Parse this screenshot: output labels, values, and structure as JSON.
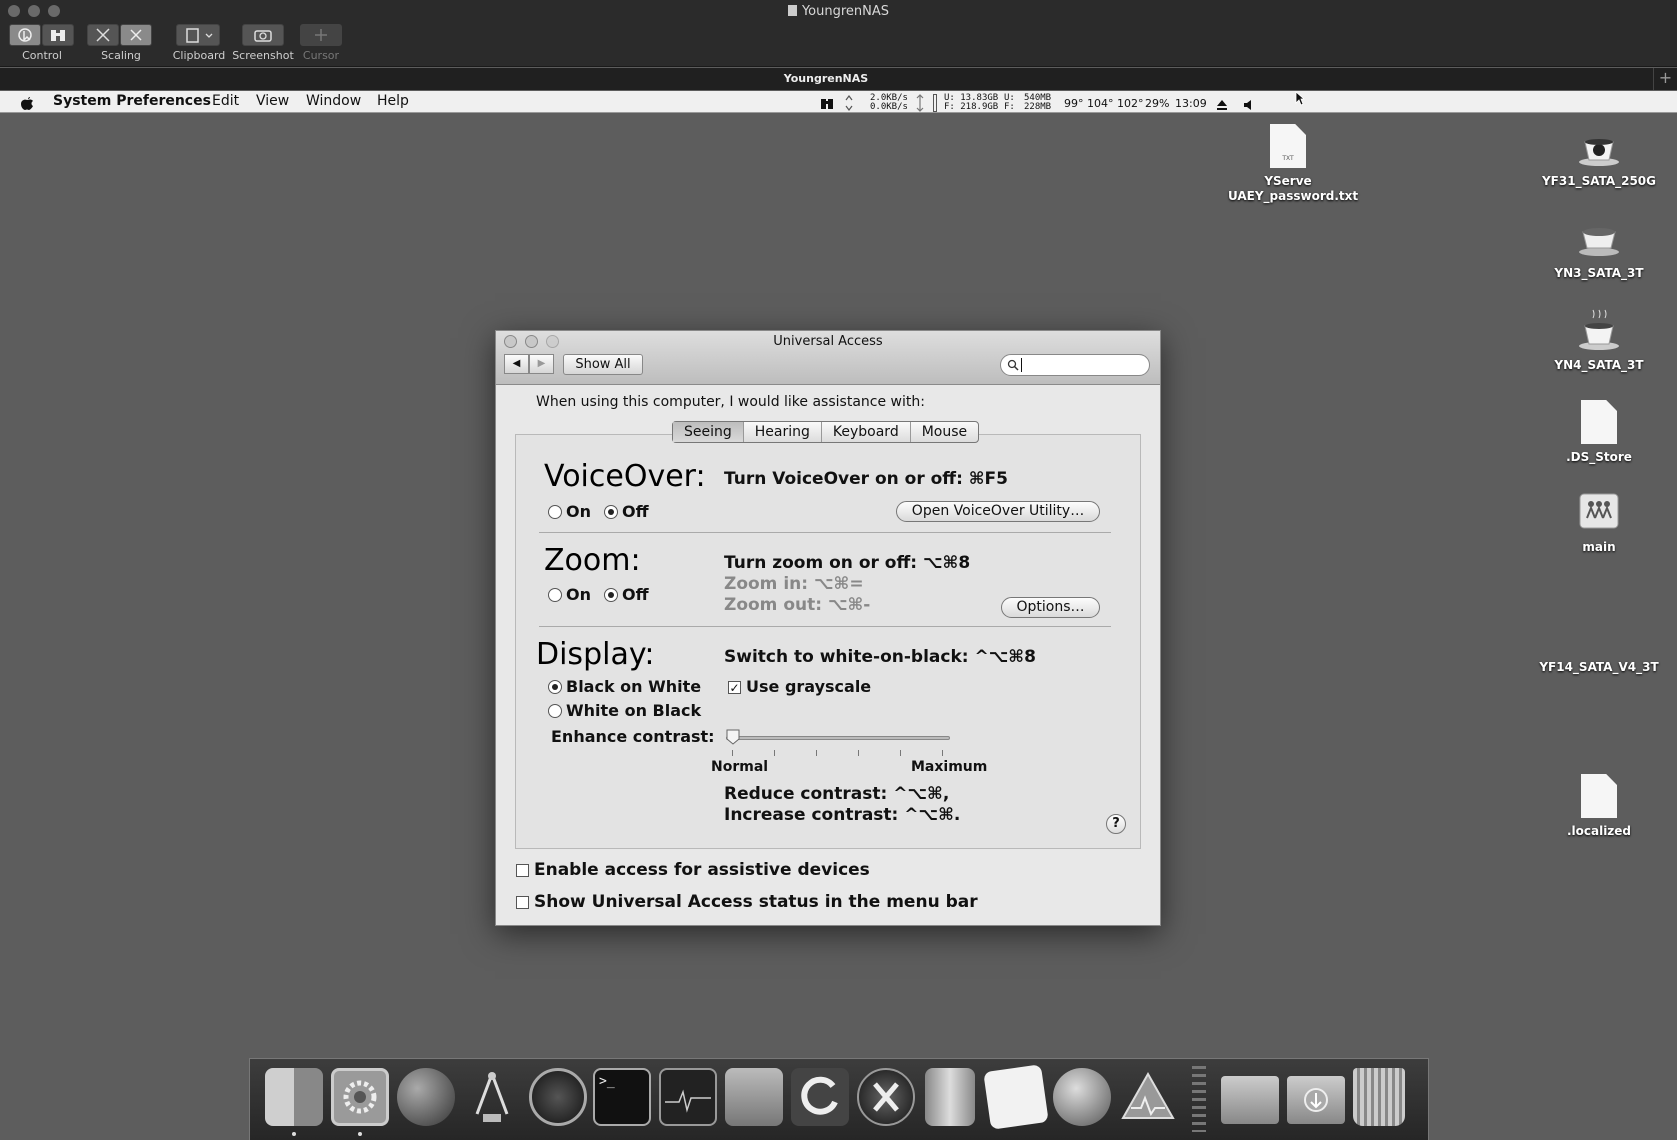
{
  "viewer": {
    "title": "YoungrenNAS",
    "tab_title": "YoungrenNAS",
    "toolbar": {
      "control": "Control",
      "scaling": "Scaling",
      "clipboard": "Clipboard",
      "screenshot": "Screenshot",
      "cursor": "Cursor"
    }
  },
  "menubar": {
    "app": "System Preferences",
    "items": [
      "Edit",
      "View",
      "Window",
      "Help"
    ],
    "status": {
      "net_up": "2.0KB/s",
      "net_down": "0.0KB/s",
      "disk_u_label": "U:",
      "disk_u": "13.83GB",
      "disk_f_label": "F:",
      "disk_f": "218.9GB",
      "mem_u_label": "U:",
      "mem_u": "540MB",
      "mem_f_label": "F:",
      "mem_f": "228MB",
      "temps": "99° 104° 102°",
      "battery": "29%",
      "clock": "13:09"
    }
  },
  "desktop": {
    "files": [
      {
        "name": "YServe UAEY_password.txt",
        "badge": "TXT"
      }
    ],
    "drives": [
      {
        "name": "YF31_SATA_250G"
      },
      {
        "name": "YN3_SATA_3T"
      },
      {
        "name": "YN4_SATA_3T"
      },
      {
        "name": ".DS_Store"
      },
      {
        "name": "main"
      },
      {
        "name": "YF14_SATA_V4_3T"
      },
      {
        "name": ".localized"
      }
    ]
  },
  "window": {
    "title": "Universal Access",
    "show_all": "Show All",
    "intro": "When using this computer, I would like assistance with:",
    "tabs": [
      "Seeing",
      "Hearing",
      "Keyboard",
      "Mouse"
    ],
    "selected_tab": "Seeing",
    "voiceover": {
      "heading": "VoiceOver:",
      "shortcut": "Turn VoiceOver on or off: ⌘F5",
      "on": "On",
      "off": "Off",
      "state": "off",
      "utility_button": "Open VoiceOver Utility…"
    },
    "zoom": {
      "heading": "Zoom:",
      "shortcut": "Turn zoom on or off: ⌥⌘8",
      "zoom_in": "Zoom in: ⌥⌘=",
      "zoom_out": "Zoom out: ⌥⌘-",
      "on": "On",
      "off": "Off",
      "state": "off",
      "options_button": "Options…"
    },
    "display": {
      "heading": "Display:",
      "shortcut": "Switch to white-on-black: ^⌥⌘8",
      "black_on_white": "Black on White",
      "white_on_black": "White on Black",
      "selected": "black_on_white",
      "grayscale": "Use grayscale",
      "grayscale_checked": true,
      "enhance_contrast": "Enhance contrast:",
      "contrast_min": "Normal",
      "contrast_max": "Maximum",
      "contrast_value": 0,
      "reduce": "Reduce contrast: ^⌥⌘,",
      "increase": "Increase contrast: ^⌥⌘."
    },
    "help": "?",
    "assistive": "Enable access for assistive devices",
    "assistive_checked": false,
    "menu_status": "Show Universal Access status in the menu bar",
    "menu_status_checked": false
  },
  "dock": {
    "items": [
      "finder-icon",
      "system-preferences-icon",
      "network-globe-icon",
      "compass-icon",
      "radar-icon",
      "terminal-icon",
      "activity-monitor-icon",
      "disk-utility-icon",
      "refresh-icon",
      "x-icon",
      "archive-icon",
      "textedit-icon",
      "globe-icon",
      "console-icon",
      "folder-icon",
      "downloads-folder-icon",
      "trash-icon"
    ]
  }
}
